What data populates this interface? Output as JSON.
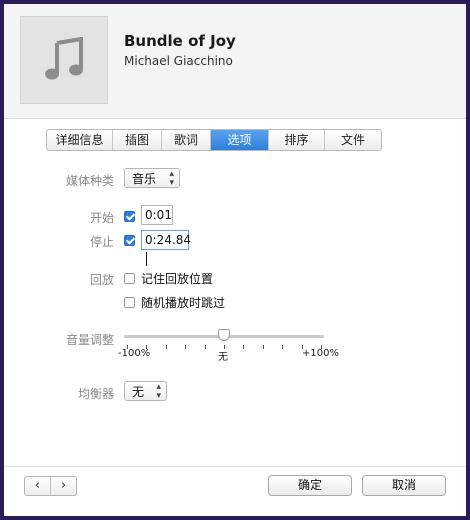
{
  "song": {
    "title": "Bundle of Joy",
    "artist": "Michael Giacchino"
  },
  "tabs": [
    {
      "label": "详细信息",
      "selected": false
    },
    {
      "label": "插图",
      "selected": false
    },
    {
      "label": "歌词",
      "selected": false
    },
    {
      "label": "选项",
      "selected": true
    },
    {
      "label": "排序",
      "selected": false
    },
    {
      "label": "文件",
      "selected": false
    }
  ],
  "options": {
    "media_kind_label": "媒体种类",
    "media_kind_value": "音乐",
    "start_label": "开始",
    "start_checked": true,
    "start_value": "0:01",
    "stop_label": "停止",
    "stop_checked": true,
    "stop_value": "0:24.84",
    "playback_label": "回放",
    "remember_position_label": "记住回放位置",
    "remember_position_checked": false,
    "skip_shuffle_label": "随机播放时跳过",
    "skip_shuffle_checked": false,
    "volume_label": "音量调整",
    "volume_min_label": "-100%",
    "volume_mid_label": "无",
    "volume_max_label": "+100%",
    "volume_level_fraction": 0.5,
    "equalizer_label": "均衡器",
    "equalizer_value": "无"
  },
  "footer": {
    "prev_icon": "‹",
    "next_icon": "›",
    "ok_label": "确定",
    "cancel_label": "取消"
  },
  "colors": {
    "accent": "#2f7fdb"
  }
}
